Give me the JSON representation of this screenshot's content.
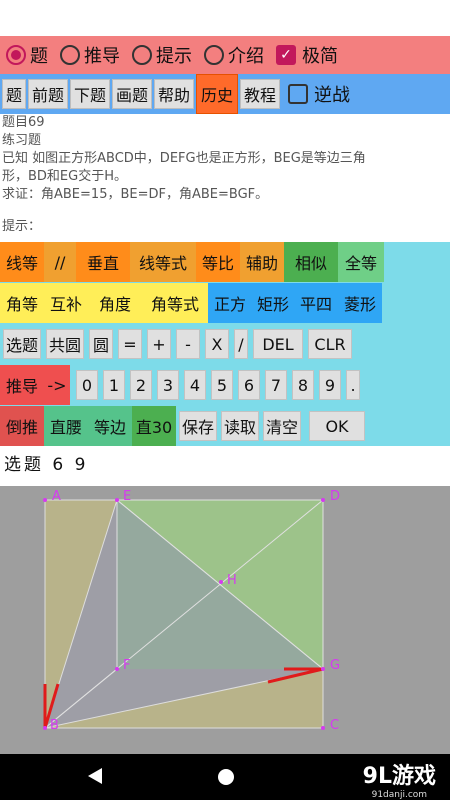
{
  "mode_bar": {
    "options": [
      {
        "label": "题",
        "selected": true
      },
      {
        "label": "推导",
        "selected": false
      },
      {
        "label": "提示",
        "selected": false
      },
      {
        "label": "介绍",
        "selected": false
      }
    ],
    "minimal": {
      "label": "极简",
      "checked": true
    }
  },
  "menu_bar": {
    "buttons": [
      "题",
      "前题",
      "下题",
      "画题",
      "帮助",
      "历史",
      "教程"
    ],
    "active": "历史",
    "reverse": {
      "label": "逆战",
      "checked": false
    }
  },
  "problem": {
    "number": "题目69",
    "type": "练习题",
    "given_line1": "已知 如图正方形ABCD中，DEFG也是正方形，BEG是等边三角",
    "given_line2": "形，BD和EG交于H。",
    "prove": "求证：角ABE=15，BE=DF，角ABE=BGF。",
    "hint_label": "提示："
  },
  "keyboard": {
    "row1": [
      "线等",
      "//",
      "垂直",
      "线等式",
      "等比",
      "辅助",
      "相似",
      "全等"
    ],
    "row2": [
      "角等",
      "互补",
      "角度",
      "角等式",
      "正方",
      "矩形",
      "平四",
      "菱形"
    ],
    "row3": [
      "选题",
      "共圆",
      "圆",
      "=",
      "+",
      "-",
      "X",
      "/",
      "DEL",
      "CLR"
    ],
    "row4_left": [
      "推导",
      "->"
    ],
    "row4_digits": [
      "0",
      "1",
      "2",
      "3",
      "4",
      "5",
      "6",
      "7",
      "8",
      "9",
      "."
    ],
    "row5_left": [
      "倒推",
      "直腰",
      "等边",
      "直30"
    ],
    "row5_right": [
      "保存",
      "读取",
      "清空",
      "OK"
    ]
  },
  "status_text": "选题 6 9",
  "figure": {
    "points": {
      "A": "A",
      "B": "B",
      "C": "C",
      "D": "D",
      "E": "E",
      "F": "F",
      "G": "G",
      "H": "H"
    }
  },
  "colors": {
    "mode_bar": "#f37f7f",
    "menu_bar": "#5fa8f2",
    "keyboard_bg": "#7ddbe9",
    "accent": "#c2185b",
    "point_label": "#d63af0"
  },
  "watermark": {
    "logo_text": "9L游戏",
    "site": "91danji.com"
  }
}
